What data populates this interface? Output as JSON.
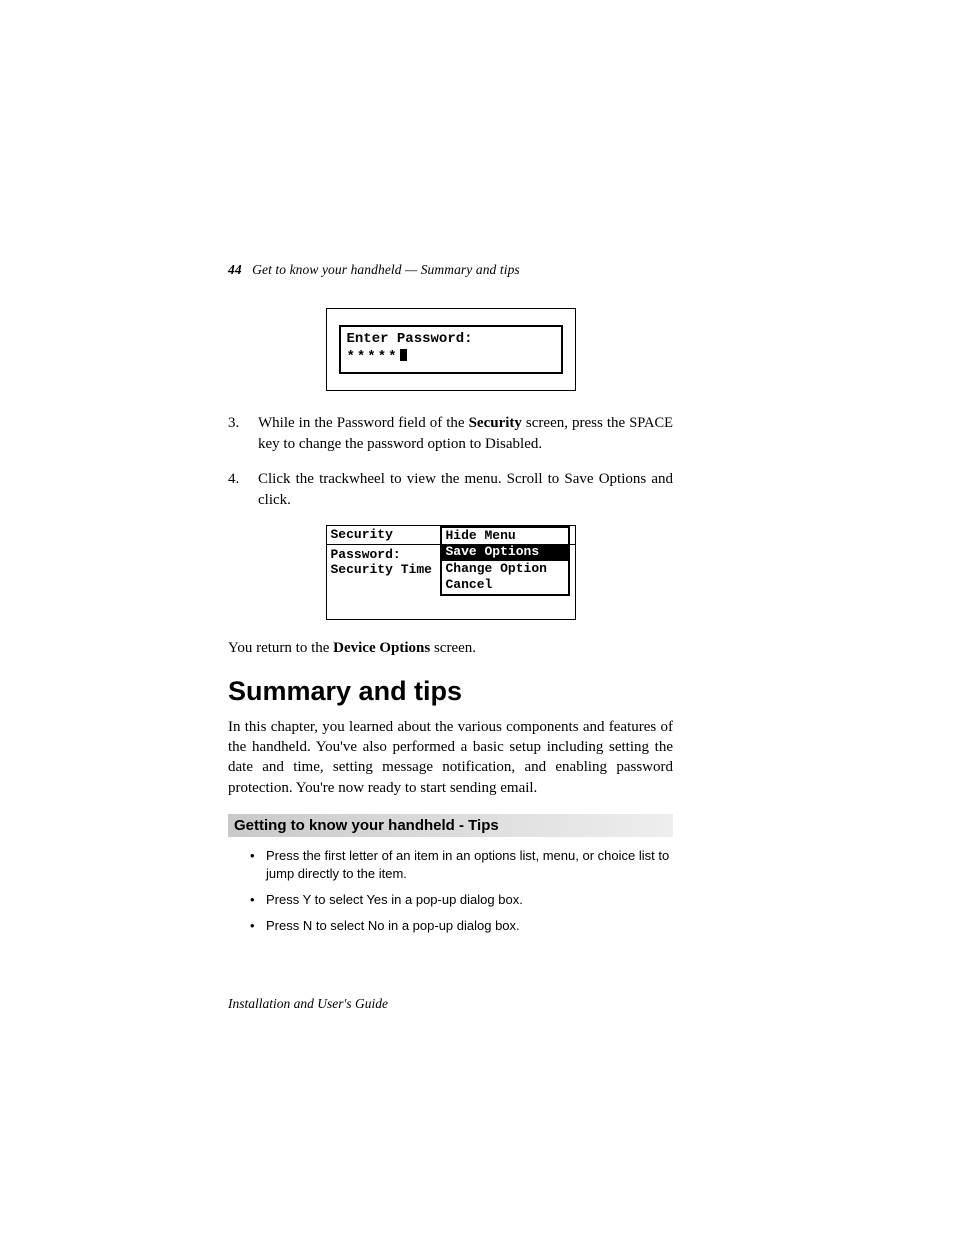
{
  "header": {
    "page_number": "44",
    "running_title_left": "Get to know your handheld",
    "separator": " — ",
    "running_title_right": "Summary and tips"
  },
  "password_screen": {
    "label": "Enter Password:",
    "mask": "*****"
  },
  "steps": [
    {
      "num": "3.",
      "before": "While in the Password field of the ",
      "bold": "Security",
      "after": " screen, press the ",
      "smallcaps": "SPACE",
      "tail": " key to change the password option to Disabled."
    },
    {
      "num": "4.",
      "text": "Click the trackwheel to view the menu. Scroll to Save Options and click."
    }
  ],
  "menu_screen": {
    "title": "Security",
    "left_line1": "Password:",
    "left_line2": "Security Time",
    "items": [
      "Hide Menu",
      "Save Options",
      "Change Option",
      "Cancel"
    ],
    "selected_index": 1
  },
  "return_para": {
    "before": "You return to the ",
    "bold": "Device Options",
    "after": " screen."
  },
  "heading": "Summary and tips",
  "summary_para": "In this chapter, you learned about the various components and features of the handheld. You've also performed a basic setup including setting the date and time, setting message notification, and enabling password protection. You're now ready to start sending email.",
  "tips_heading": "Getting to know your handheld - Tips",
  "tips": [
    "Press the first letter of an item in an options list, menu, or choice list to jump directly to the item.",
    "Press Y to select Yes in a pop-up dialog box.",
    "Press N to select No in a pop-up dialog box."
  ],
  "footer": "Installation and User's Guide"
}
